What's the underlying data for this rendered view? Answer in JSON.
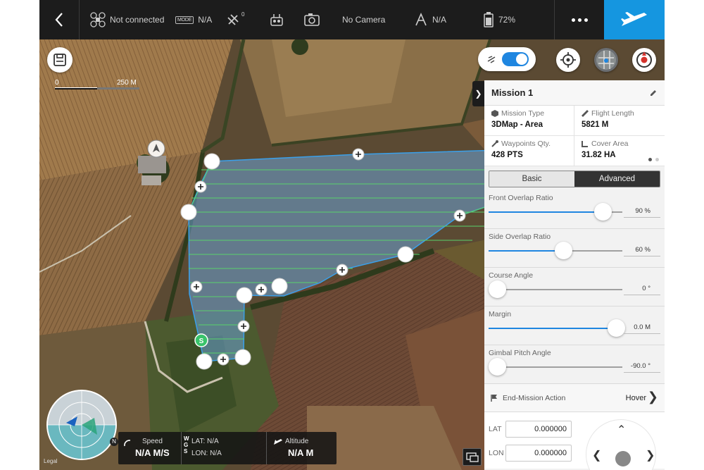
{
  "topbar": {
    "connection": "Not connected",
    "mode_badge": "MODE",
    "mode_value": "N/A",
    "satellites": "0",
    "camera": "No Camera",
    "gps_value": "N/A",
    "battery": "72%"
  },
  "map": {
    "scale_start": "0",
    "scale_end": "250 M",
    "start_marker": "S"
  },
  "mission": {
    "title": "Mission 1",
    "stats": {
      "mission_type_label": "Mission Type",
      "mission_type_value": "3DMap - Area",
      "flight_length_label": "Flight Length",
      "flight_length_value": "5821 M",
      "waypoints_label": "Waypoints Qty.",
      "waypoints_value": "428 PTS",
      "cover_area_label": "Cover Area",
      "cover_area_value": "31.82 HA"
    },
    "tabs": {
      "basic": "Basic",
      "advanced": "Advanced",
      "active": "advanced"
    },
    "settings": [
      {
        "label": "Front Overlap Ratio",
        "value": "90 %",
        "fraction": 0.85
      },
      {
        "label": "Side Overlap Ratio",
        "value": "60 %",
        "fraction": 0.56
      },
      {
        "label": "Course Angle",
        "value": "0 °",
        "fraction": 0.0
      },
      {
        "label": "Margin",
        "value": "0.0 M",
        "fraction": 0.95
      },
      {
        "label": "Gimbal Pitch Angle",
        "value": "-90.0 °",
        "fraction": 0.0
      }
    ],
    "end_action": {
      "label": "End-Mission Action",
      "value": "Hover"
    },
    "lat_label": "LAT",
    "lat_value": "0.000000",
    "lon_label": "LON",
    "lon_value": "0.000000"
  },
  "hud": {
    "speed_label": "Speed",
    "speed_value": "N/A M/S",
    "wgs_label": "WGS",
    "lat_text": "LAT: N/A",
    "lon_text": "LON: N/A",
    "altitude_label": "Altitude",
    "altitude_value": "N/A M",
    "radar_north": "N",
    "legal": "Legal"
  },
  "colors": {
    "accent": "#1596e0",
    "slider": "#1f86e0",
    "area_fill": "#6aa3d6",
    "area_border": "#3aa0ea",
    "flight_lines": "#59d36b",
    "start_marker": "#39c36b"
  }
}
